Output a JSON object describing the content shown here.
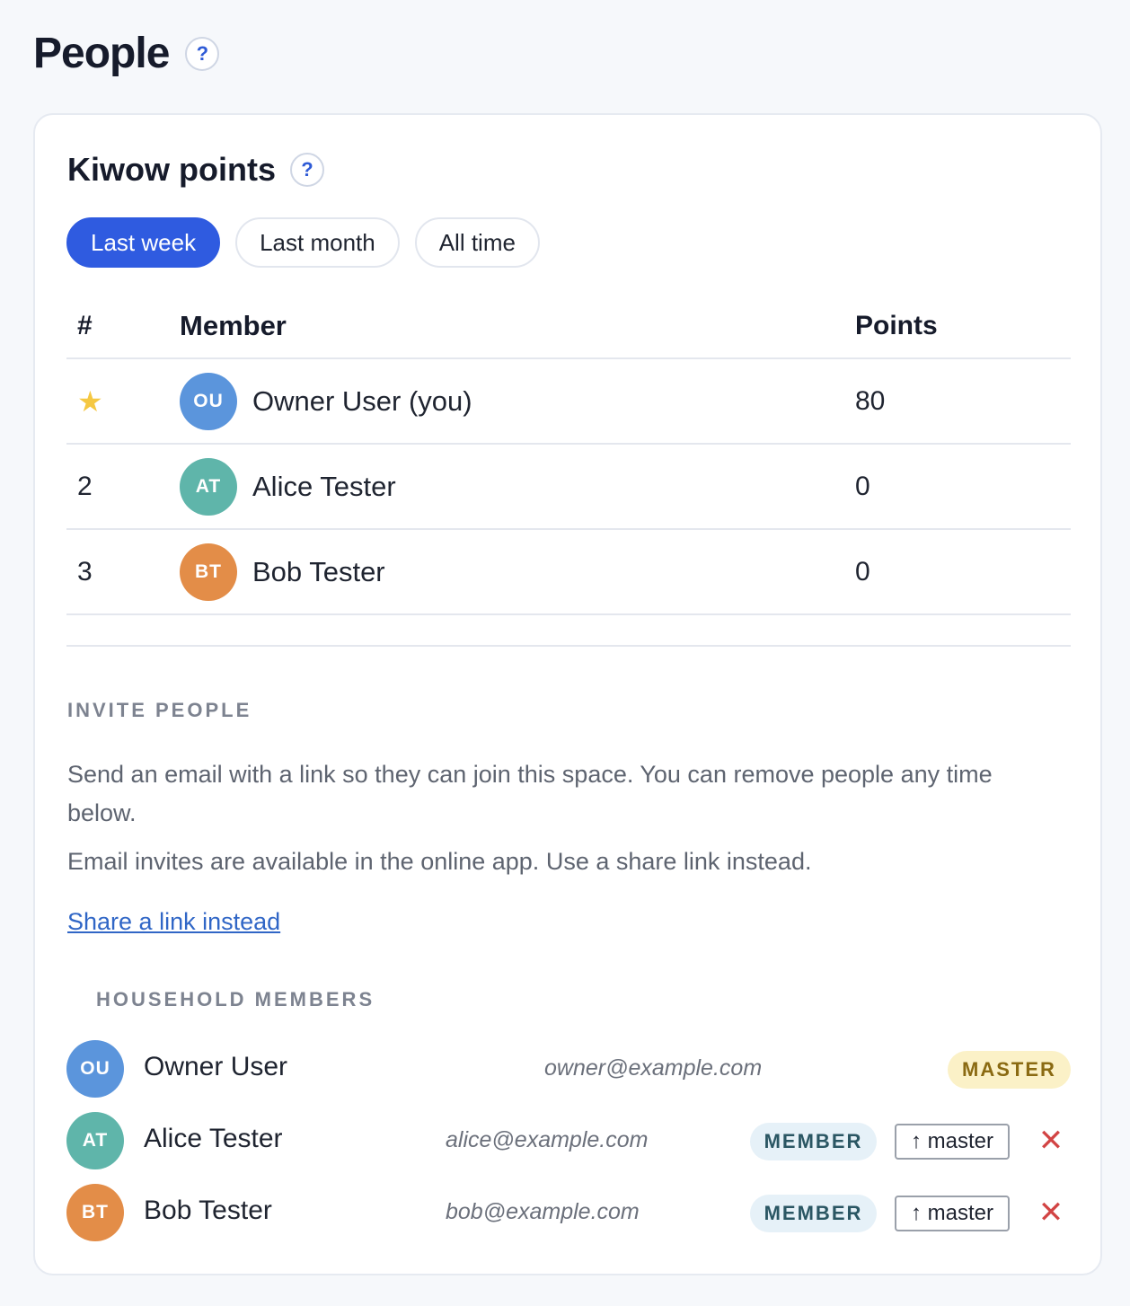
{
  "page": {
    "title": "People",
    "help_icon": "?"
  },
  "points_section": {
    "title": "Kiwow points",
    "help_icon": "?",
    "tabs": [
      {
        "label": "Last week",
        "active": true
      },
      {
        "label": "Last month",
        "active": false
      },
      {
        "label": "All time",
        "active": false
      }
    ]
  },
  "leaderboard": {
    "headers": {
      "rank": "#",
      "member": "Member",
      "points": "Points"
    },
    "rows": [
      {
        "rank": "★",
        "rank_icon": "star-icon",
        "initials": "OU",
        "name": "Owner User (you)",
        "points": "80",
        "avatar_color": "#5b95dc"
      },
      {
        "rank": "2",
        "initials": "AT",
        "name": "Alice Tester",
        "points": "0",
        "avatar_color": "#5fb5aa"
      },
      {
        "rank": "3",
        "initials": "BT",
        "name": "Bob Tester",
        "points": "0",
        "avatar_color": "#e38d48"
      }
    ]
  },
  "invite": {
    "label": "INVITE PEOPLE",
    "description": "Send an email with a link so they can join this space. You can remove people any time below.",
    "note": "Email invites are available in the online app. Use a share link instead.",
    "share_link": "Share a link instead"
  },
  "household": {
    "label": "HOUSEHOLD MEMBERS",
    "members": [
      {
        "initials": "OU",
        "name": "Owner User",
        "email": "owner@example.com",
        "role": "MASTER",
        "avatar_color": "#5b95dc"
      },
      {
        "initials": "AT",
        "name": "Alice Tester",
        "email": "alice@example.com",
        "role": "MEMBER",
        "promote_label": "↑ master",
        "remove_icon": "✕",
        "avatar_color": "#5fb5aa"
      },
      {
        "initials": "BT",
        "name": "Bob Tester",
        "email": "bob@example.com",
        "role": "MEMBER",
        "promote_label": "↑ master",
        "remove_icon": "✕",
        "avatar_color": "#e38d48"
      }
    ]
  },
  "colors": {
    "accent": "#2f5be0",
    "link": "#3066c6",
    "remove": "#d24444",
    "star": "#f5c842"
  }
}
